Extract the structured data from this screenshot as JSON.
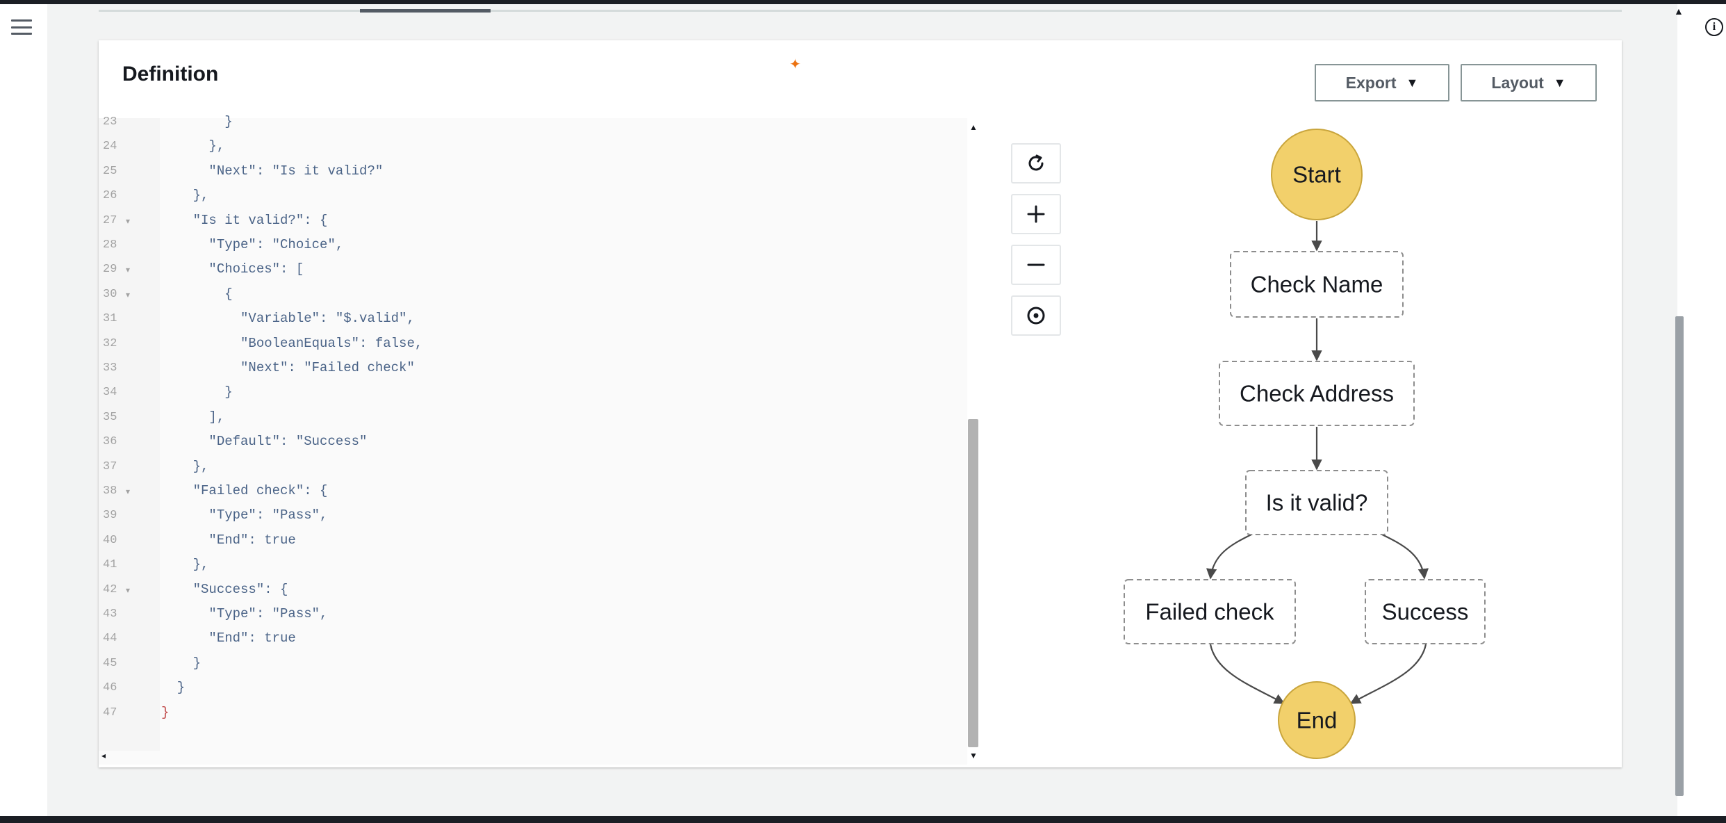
{
  "panel": {
    "title": "Definition"
  },
  "toolbar": {
    "export_label": "Export",
    "layout_label": "Layout"
  },
  "graph_controls": [
    "reset-view",
    "zoom-in",
    "zoom-out",
    "center-graph"
  ],
  "editor": {
    "lines": [
      {
        "n": "23",
        "text": "        }",
        "fold": false
      },
      {
        "n": "24",
        "text": "      },",
        "fold": false
      },
      {
        "n": "25",
        "text": "      \"Next\": \"Is it valid?\"",
        "fold": false
      },
      {
        "n": "26",
        "text": "    },",
        "fold": false
      },
      {
        "n": "27",
        "text": "    \"Is it valid?\": {",
        "fold": true
      },
      {
        "n": "28",
        "text": "      \"Type\": \"Choice\",",
        "fold": false
      },
      {
        "n": "29",
        "text": "      \"Choices\": [",
        "fold": true
      },
      {
        "n": "30",
        "text": "        {",
        "fold": true
      },
      {
        "n": "31",
        "text": "          \"Variable\": \"$.valid\",",
        "fold": false
      },
      {
        "n": "32",
        "text": "          \"BooleanEquals\": false,",
        "fold": false
      },
      {
        "n": "33",
        "text": "          \"Next\": \"Failed check\"",
        "fold": false
      },
      {
        "n": "34",
        "text": "        }",
        "fold": false
      },
      {
        "n": "35",
        "text": "      ],",
        "fold": false
      },
      {
        "n": "36",
        "text": "      \"Default\": \"Success\"",
        "fold": false
      },
      {
        "n": "37",
        "text": "    },",
        "fold": false
      },
      {
        "n": "38",
        "text": "    \"Failed check\": {",
        "fold": true
      },
      {
        "n": "39",
        "text": "      \"Type\": \"Pass\",",
        "fold": false
      },
      {
        "n": "40",
        "text": "      \"End\": true",
        "fold": false
      },
      {
        "n": "41",
        "text": "    },",
        "fold": false
      },
      {
        "n": "42",
        "text": "    \"Success\": {",
        "fold": true
      },
      {
        "n": "43",
        "text": "      \"Type\": \"Pass\",",
        "fold": false
      },
      {
        "n": "44",
        "text": "      \"End\": true",
        "fold": false
      },
      {
        "n": "45",
        "text": "    }",
        "fold": false
      },
      {
        "n": "46",
        "text": "  }",
        "fold": false
      },
      {
        "n": "47",
        "text": "}",
        "fold": false
      }
    ]
  },
  "workflow": {
    "nodes": {
      "start": "Start",
      "check_name": "Check Name",
      "check_address": "Check Address",
      "is_valid": "Is it valid?",
      "failed_check": "Failed check",
      "success": "Success",
      "end": "End"
    },
    "colors": {
      "terminal_fill": "#f2d06b",
      "terminal_stroke": "#c9a53c"
    }
  }
}
